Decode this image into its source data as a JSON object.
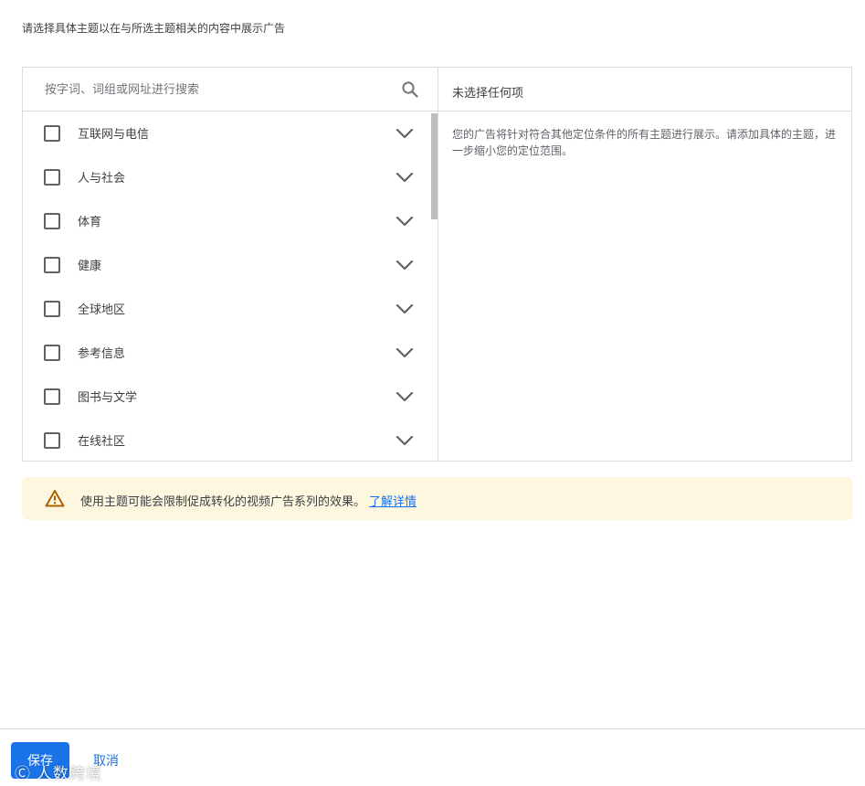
{
  "instruction": "请选择具体主题以在与所选主题相关的内容中展示广告",
  "search": {
    "placeholder": "按字词、词组或网址进行搜索",
    "icon": "search-icon"
  },
  "topics": [
    {
      "label": "互联网与电信"
    },
    {
      "label": "人与社会"
    },
    {
      "label": "体育"
    },
    {
      "label": "健康"
    },
    {
      "label": "全球地区"
    },
    {
      "label": "参考信息"
    },
    {
      "label": "图书与文学"
    },
    {
      "label": "在线社区"
    }
  ],
  "selected_panel": {
    "header": "未选择任何项",
    "description": "您的广告将针对符合其他定位条件的所有主题进行展示。请添加具体的主题，进一步缩小您的定位范围。"
  },
  "warning": {
    "text": "使用主题可能会限制促成转化的视频广告系列的效果。",
    "link": "了解详情",
    "icon": "warning-triangle-icon"
  },
  "footer": {
    "save_label": "保存",
    "cancel_label": "取消"
  },
  "watermark": "Ⓒ 人数跨境",
  "colors": {
    "primary": "#1a73e8",
    "warning_bg": "#fef7e0",
    "warning_icon": "#b06000",
    "border": "#dadce0"
  }
}
